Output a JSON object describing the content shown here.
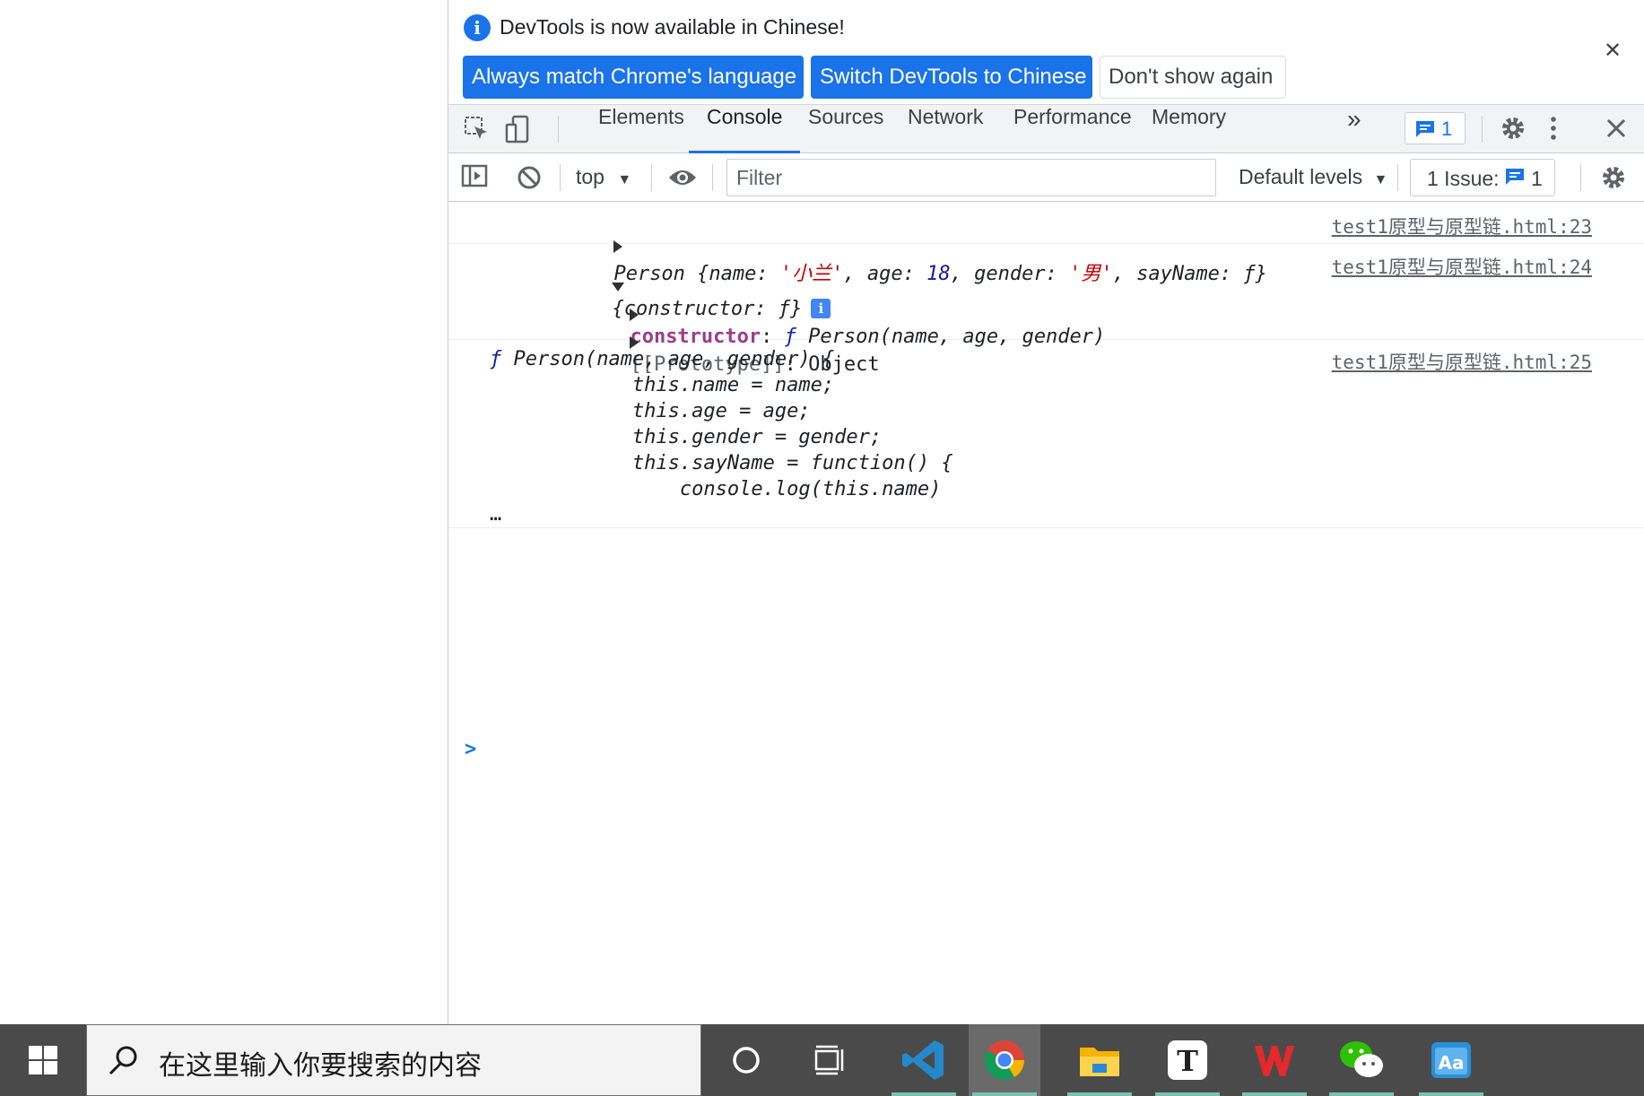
{
  "infobar": {
    "message": "DevTools is now available in Chinese!",
    "btn_match": "Always match Chrome's language",
    "btn_switch": "Switch DevTools to Chinese",
    "btn_dont": "Don't show again",
    "close": "✕"
  },
  "tabs": {
    "elements": "Elements",
    "console": "Console",
    "sources": "Sources",
    "network": "Network",
    "performance": "Performance",
    "memory": "Memory",
    "more": "»",
    "message_count": "1"
  },
  "console_toolbar": {
    "context": "top",
    "filter_placeholder": "Filter",
    "levels": "Default levels",
    "issues_label": "1 Issue:",
    "issues_count": "1"
  },
  "logs": [
    {
      "source": "test1原型与原型链.html:23",
      "summary_prefix": "Person {",
      "k_name": "name",
      "v_name": "'小兰'",
      "k_age": "age",
      "v_age": "18",
      "k_gender": "gender",
      "v_gender": "'男'",
      "k_sayname": "sayName",
      "v_sayname": "ƒ",
      "summary_suffix": "}"
    },
    {
      "source": "test1原型与原型链.html:24",
      "summary": "{constructor: ƒ}",
      "info_badge": "i",
      "child1_key": "constructor",
      "child1_f": "ƒ",
      "child1_value": "Person(name, age, gender)",
      "child2_key": "[[Prototype]]",
      "child2_value": "Object"
    },
    {
      "source": "test1原型与原型链.html:25",
      "f": "ƒ",
      "lines": [
        "Person(name, age, gender) {",
        "            this.name = name;",
        "            this.age = age;",
        "            this.gender = gender;",
        "            this.sayName = function() {",
        "                console.log(this.name)"
      ],
      "ellipsis": "…"
    }
  ],
  "prompt": ">",
  "taskbar": {
    "search_placeholder": "在这里输入你要搜索的内容"
  },
  "colors": {
    "accent": "#1a73e8",
    "taskbar": "#4a4a4a",
    "string": "#c80000",
    "number": "#1a1aa6"
  }
}
